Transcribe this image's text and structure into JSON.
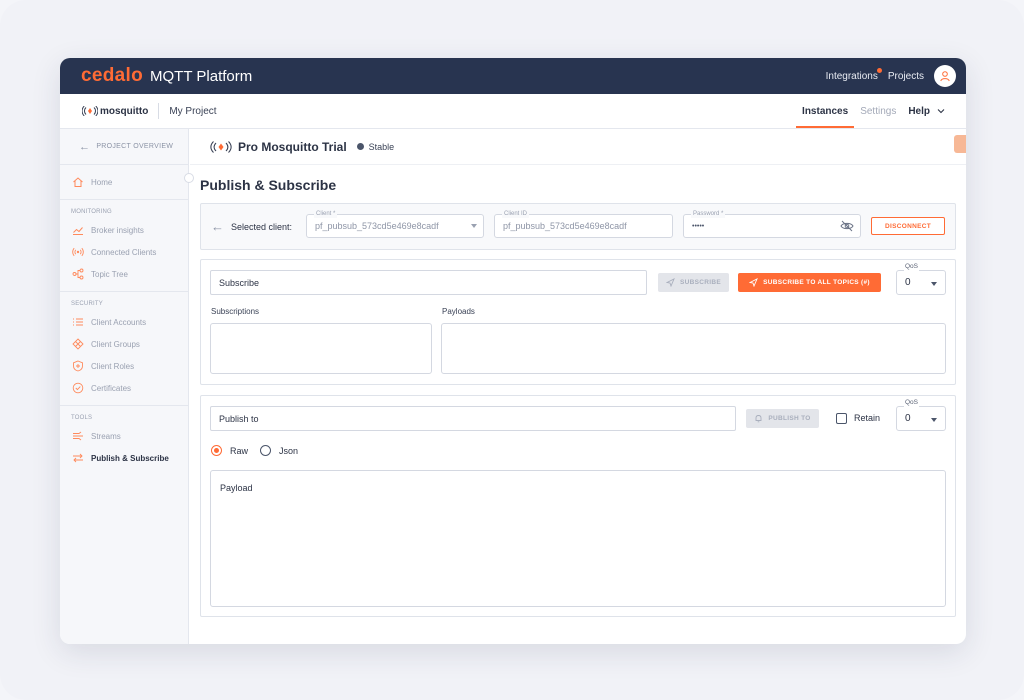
{
  "app": {
    "brand_logo": "cedalo",
    "brand_name": "MQTT Platform"
  },
  "topbar": {
    "integrations": "Integrations",
    "projects": "Projects"
  },
  "subbar": {
    "logo_text": "mosquitto",
    "project": "My Project",
    "tabs": [
      {
        "label": "Instances",
        "active": true
      },
      {
        "label": "Settings",
        "active": false
      },
      {
        "label": "Help",
        "active": false
      }
    ]
  },
  "sidebar": {
    "back_label": "PROJECT OVERVIEW",
    "home": "Home",
    "sections": {
      "monitoring": "MONITORING",
      "security": "SECURITY",
      "tools": "TOOLS"
    },
    "monitoring_items": [
      "Broker insights",
      "Connected Clients",
      "Topic Tree"
    ],
    "security_items": [
      "Client Accounts",
      "Client Groups",
      "Client Roles",
      "Certificates"
    ],
    "tools_items": [
      "Streams",
      "Publish & Subscribe"
    ]
  },
  "instance": {
    "name": "Pro Mosquitto Trial",
    "status": "Stable"
  },
  "page": {
    "title": "Publish & Subscribe"
  },
  "client": {
    "selected_label": "Selected client:",
    "client_label": "Client *",
    "client_value": "pf_pubsub_573cd5e469e8cadf",
    "client_id_label": "Client ID",
    "client_id_value": "pf_pubsub_573cd5e469e8cadf",
    "password_label": "Password *",
    "password_value": "•••••",
    "disconnect": "DISCONNECT"
  },
  "subscribe": {
    "topic_value": "Subscribe",
    "subscribe_btn": "SUBSCRIBE",
    "subscribe_all_btn": "SUBSCRIBE TO ALL TOPICS (#)",
    "qos_label": "QoS",
    "qos_value": "0",
    "subscriptions_label": "Subscriptions",
    "payloads_label": "Payloads"
  },
  "publish": {
    "topic_value": "Publish to",
    "publish_btn": "PUBLISH TO",
    "retain_label": "Retain",
    "qos_label": "QoS",
    "qos_value": "0",
    "raw_label": "Raw",
    "json_label": "Json",
    "format_selected": "Raw",
    "payload_value": "Payload"
  },
  "colors": {
    "accent": "#ff6b35",
    "topbar": "#283450"
  }
}
